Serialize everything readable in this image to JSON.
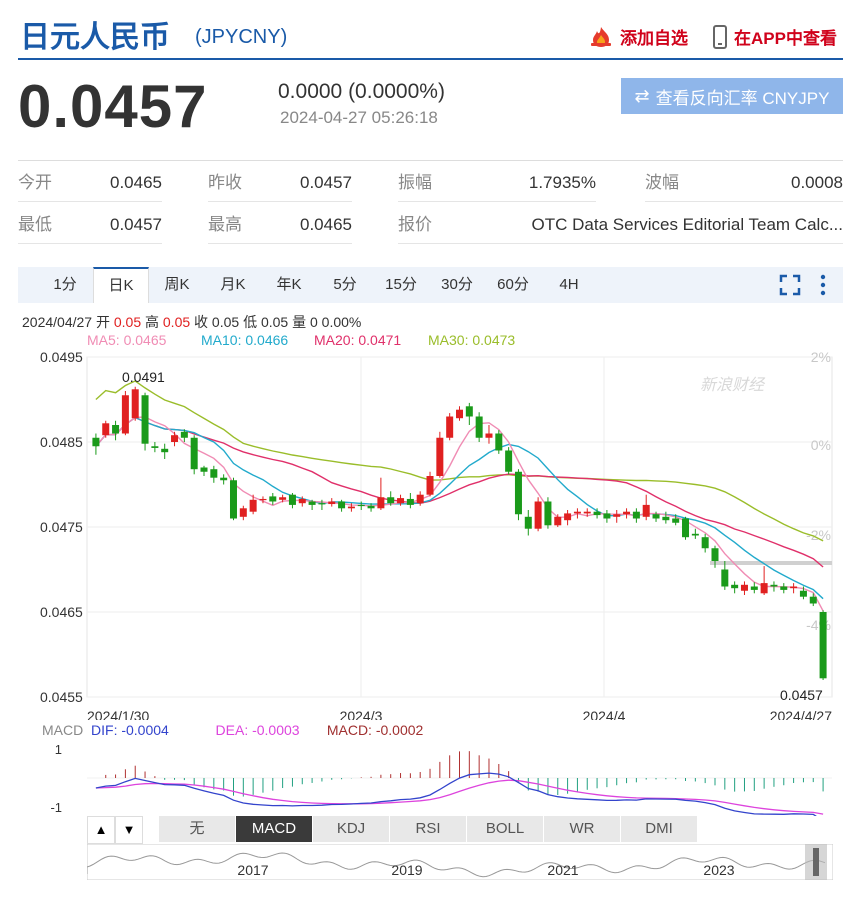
{
  "header": {
    "title": "日元人民币",
    "code": "(JPYCNY)",
    "add_watch": "添加自选",
    "app_view": "在APP中查看"
  },
  "quote": {
    "price": "0.0457",
    "change": "0.0000 (0.0000%)",
    "timestamp": "2024-04-27 05:26:18",
    "reverse_button": "查看反向汇率 CNYJPY"
  },
  "stats": {
    "row1": [
      {
        "label": "今开",
        "value": "0.0465"
      },
      {
        "label": "昨收",
        "value": "0.0457"
      },
      {
        "label": "振幅",
        "value": "1.7935%"
      },
      {
        "label": "波幅",
        "value": "0.0008"
      }
    ],
    "row2": [
      {
        "label": "最低",
        "value": "0.0457"
      },
      {
        "label": "最高",
        "value": "0.0465"
      },
      {
        "label": "报价",
        "value": "OTC Data Services Editorial Team Calc..."
      }
    ]
  },
  "tabs": [
    "1分",
    "日K",
    "周K",
    "月K",
    "年K",
    "5分",
    "15分",
    "30分",
    "60分",
    "4H"
  ],
  "active_tab": "日K",
  "info_line": {
    "date": "2024/04/27",
    "open_label": "开",
    "open": "0.05",
    "high_label": "高",
    "high": "0.05",
    "close_label": "收",
    "close": "0.05",
    "low_label": "低",
    "low": "0.05",
    "vol_label": "量",
    "vol": "0 0.00%"
  },
  "ma_legend": [
    "MA5: 0.0465",
    "MA10: 0.0466",
    "MA20: 0.0471",
    "MA30: 0.0473"
  ],
  "watermark": "新浪财经",
  "macd_legend": {
    "name": "MACD",
    "dif": "DIF: -0.0004",
    "dea": "DEA: -0.0003",
    "macd": "MACD: -0.0002"
  },
  "indicator_buttons": [
    "无",
    "MACD",
    "KDJ",
    "RSI",
    "BOLL",
    "WR",
    "DMI"
  ],
  "active_indicator": "MACD",
  "overview_years": [
    "2017",
    "2019",
    "2021",
    "2023"
  ],
  "colors": {
    "up": "#e02020",
    "down": "#1a9a1a",
    "ma5": "#f08cb4",
    "ma10": "#22aacc",
    "ma20": "#e0306a",
    "ma30": "#9abd2a",
    "dif": "#3344cc",
    "dea": "#dd44dd",
    "accent": "#1a5aa8"
  },
  "chart_data": {
    "type": "candlestick",
    "title": "",
    "y_ticks": [
      "0.0495",
      "0.0485",
      "0.0475",
      "0.0465",
      "0.0455"
    ],
    "ylim": [
      0.0455,
      0.0495
    ],
    "pct_ticks": [
      "2%",
      "0%",
      "-2%",
      "-4%"
    ],
    "x_ticks": [
      "2024/1/30",
      "2024/3",
      "2024/4",
      "2024/4/27"
    ],
    "annotations": [
      {
        "text": "0.0491"
      },
      {
        "text": "0.0457"
      }
    ],
    "candles": [
      [
        0.04855,
        0.04845,
        0.0486,
        0.04835
      ],
      [
        0.04858,
        0.04872,
        0.04875,
        0.04855
      ],
      [
        0.0487,
        0.0486,
        0.04875,
        0.04852
      ],
      [
        0.0486,
        0.04905,
        0.0491,
        0.04858
      ],
      [
        0.04878,
        0.04912,
        0.04915,
        0.04875
      ],
      [
        0.04905,
        0.04848,
        0.04908,
        0.0484
      ],
      [
        0.04845,
        0.04843,
        0.0485,
        0.04838
      ],
      [
        0.04842,
        0.04838,
        0.04848,
        0.0483
      ],
      [
        0.0485,
        0.04858,
        0.04862,
        0.04845
      ],
      [
        0.04862,
        0.04855,
        0.04865,
        0.0485
      ],
      [
        0.04855,
        0.04818,
        0.04858,
        0.04812
      ],
      [
        0.0482,
        0.04815,
        0.04822,
        0.0481
      ],
      [
        0.04818,
        0.04808,
        0.04822,
        0.04802
      ],
      [
        0.04808,
        0.04805,
        0.04812,
        0.048
      ],
      [
        0.04805,
        0.0476,
        0.04808,
        0.04758
      ],
      [
        0.04762,
        0.04772,
        0.04775,
        0.04758
      ],
      [
        0.04768,
        0.04782,
        0.04788,
        0.04765
      ],
      [
        0.04782,
        0.04783,
        0.04786,
        0.04778
      ],
      [
        0.04786,
        0.0478,
        0.0479,
        0.04776
      ],
      [
        0.04782,
        0.04785,
        0.04788,
        0.04779
      ],
      [
        0.04788,
        0.04776,
        0.0479,
        0.04772
      ],
      [
        0.04778,
        0.04783,
        0.04786,
        0.04774
      ],
      [
        0.0478,
        0.04776,
        0.04782,
        0.0477
      ],
      [
        0.04778,
        0.04777,
        0.04782,
        0.0477
      ],
      [
        0.04777,
        0.0478,
        0.04784,
        0.04774
      ],
      [
        0.0478,
        0.04772,
        0.04782,
        0.04768
      ],
      [
        0.04772,
        0.04774,
        0.04778,
        0.04768
      ],
      [
        0.04776,
        0.04775,
        0.0478,
        0.0477
      ],
      [
        0.04775,
        0.04772,
        0.04778,
        0.04768
      ],
      [
        0.04772,
        0.04785,
        0.04808,
        0.0477
      ],
      [
        0.04785,
        0.04778,
        0.04792,
        0.04775
      ],
      [
        0.04778,
        0.04784,
        0.04788,
        0.04775
      ],
      [
        0.04783,
        0.04776,
        0.0479,
        0.04772
      ],
      [
        0.04778,
        0.04788,
        0.04792,
        0.04775
      ],
      [
        0.04788,
        0.0481,
        0.04815,
        0.04786
      ],
      [
        0.0481,
        0.04855,
        0.04862,
        0.04808
      ],
      [
        0.04855,
        0.0488,
        0.04884,
        0.04852
      ],
      [
        0.04878,
        0.04888,
        0.04892,
        0.04875
      ],
      [
        0.04892,
        0.0488,
        0.04896,
        0.0487
      ],
      [
        0.0488,
        0.04855,
        0.04885,
        0.0485
      ],
      [
        0.04855,
        0.0486,
        0.0487,
        0.04848
      ],
      [
        0.0486,
        0.0484,
        0.04864,
        0.04836
      ],
      [
        0.0484,
        0.04815,
        0.04844,
        0.04812
      ],
      [
        0.04815,
        0.04765,
        0.04818,
        0.04758
      ],
      [
        0.04762,
        0.04748,
        0.0477,
        0.0474
      ],
      [
        0.04748,
        0.0478,
        0.04785,
        0.04745
      ],
      [
        0.0478,
        0.04752,
        0.04785,
        0.04748
      ],
      [
        0.04752,
        0.04762,
        0.04765,
        0.0475
      ],
      [
        0.04758,
        0.04766,
        0.0477,
        0.04752
      ],
      [
        0.04766,
        0.04768,
        0.04772,
        0.0476
      ],
      [
        0.04766,
        0.04768,
        0.04772,
        0.04762
      ],
      [
        0.04768,
        0.04764,
        0.04772,
        0.0476
      ],
      [
        0.04766,
        0.0476,
        0.0477,
        0.04755
      ],
      [
        0.04762,
        0.04765,
        0.0477,
        0.04755
      ],
      [
        0.04765,
        0.04768,
        0.04772,
        0.0476
      ],
      [
        0.04768,
        0.0476,
        0.04772,
        0.04755
      ],
      [
        0.04762,
        0.04776,
        0.04788,
        0.04758
      ],
      [
        0.04765,
        0.0476,
        0.04768,
        0.04756
      ],
      [
        0.04762,
        0.04758,
        0.04768,
        0.04754
      ],
      [
        0.0476,
        0.04755,
        0.04765,
        0.04752
      ],
      [
        0.0476,
        0.04738,
        0.04762,
        0.04735
      ],
      [
        0.04742,
        0.0474,
        0.04748,
        0.04736
      ],
      [
        0.04738,
        0.04725,
        0.04742,
        0.0472
      ],
      [
        0.04725,
        0.0471,
        0.04728,
        0.04702
      ],
      [
        0.047,
        0.0468,
        0.0471,
        0.04676
      ],
      [
        0.04682,
        0.04678,
        0.04686,
        0.04672
      ],
      [
        0.04675,
        0.04682,
        0.04686,
        0.0467
      ],
      [
        0.0468,
        0.04676,
        0.04685,
        0.04672
      ],
      [
        0.04672,
        0.04684,
        0.04704,
        0.0467
      ],
      [
        0.04682,
        0.0468,
        0.04686,
        0.04674
      ],
      [
        0.0468,
        0.04676,
        0.04684,
        0.04672
      ],
      [
        0.04678,
        0.0468,
        0.04684,
        0.04672
      ],
      [
        0.04675,
        0.04668,
        0.0468,
        0.04665
      ],
      [
        0.04668,
        0.0466,
        0.04672,
        0.04657
      ],
      [
        0.0465,
        0.04572,
        0.04652,
        0.0457
      ]
    ],
    "macd_axis": [
      "1",
      "-1"
    ]
  }
}
